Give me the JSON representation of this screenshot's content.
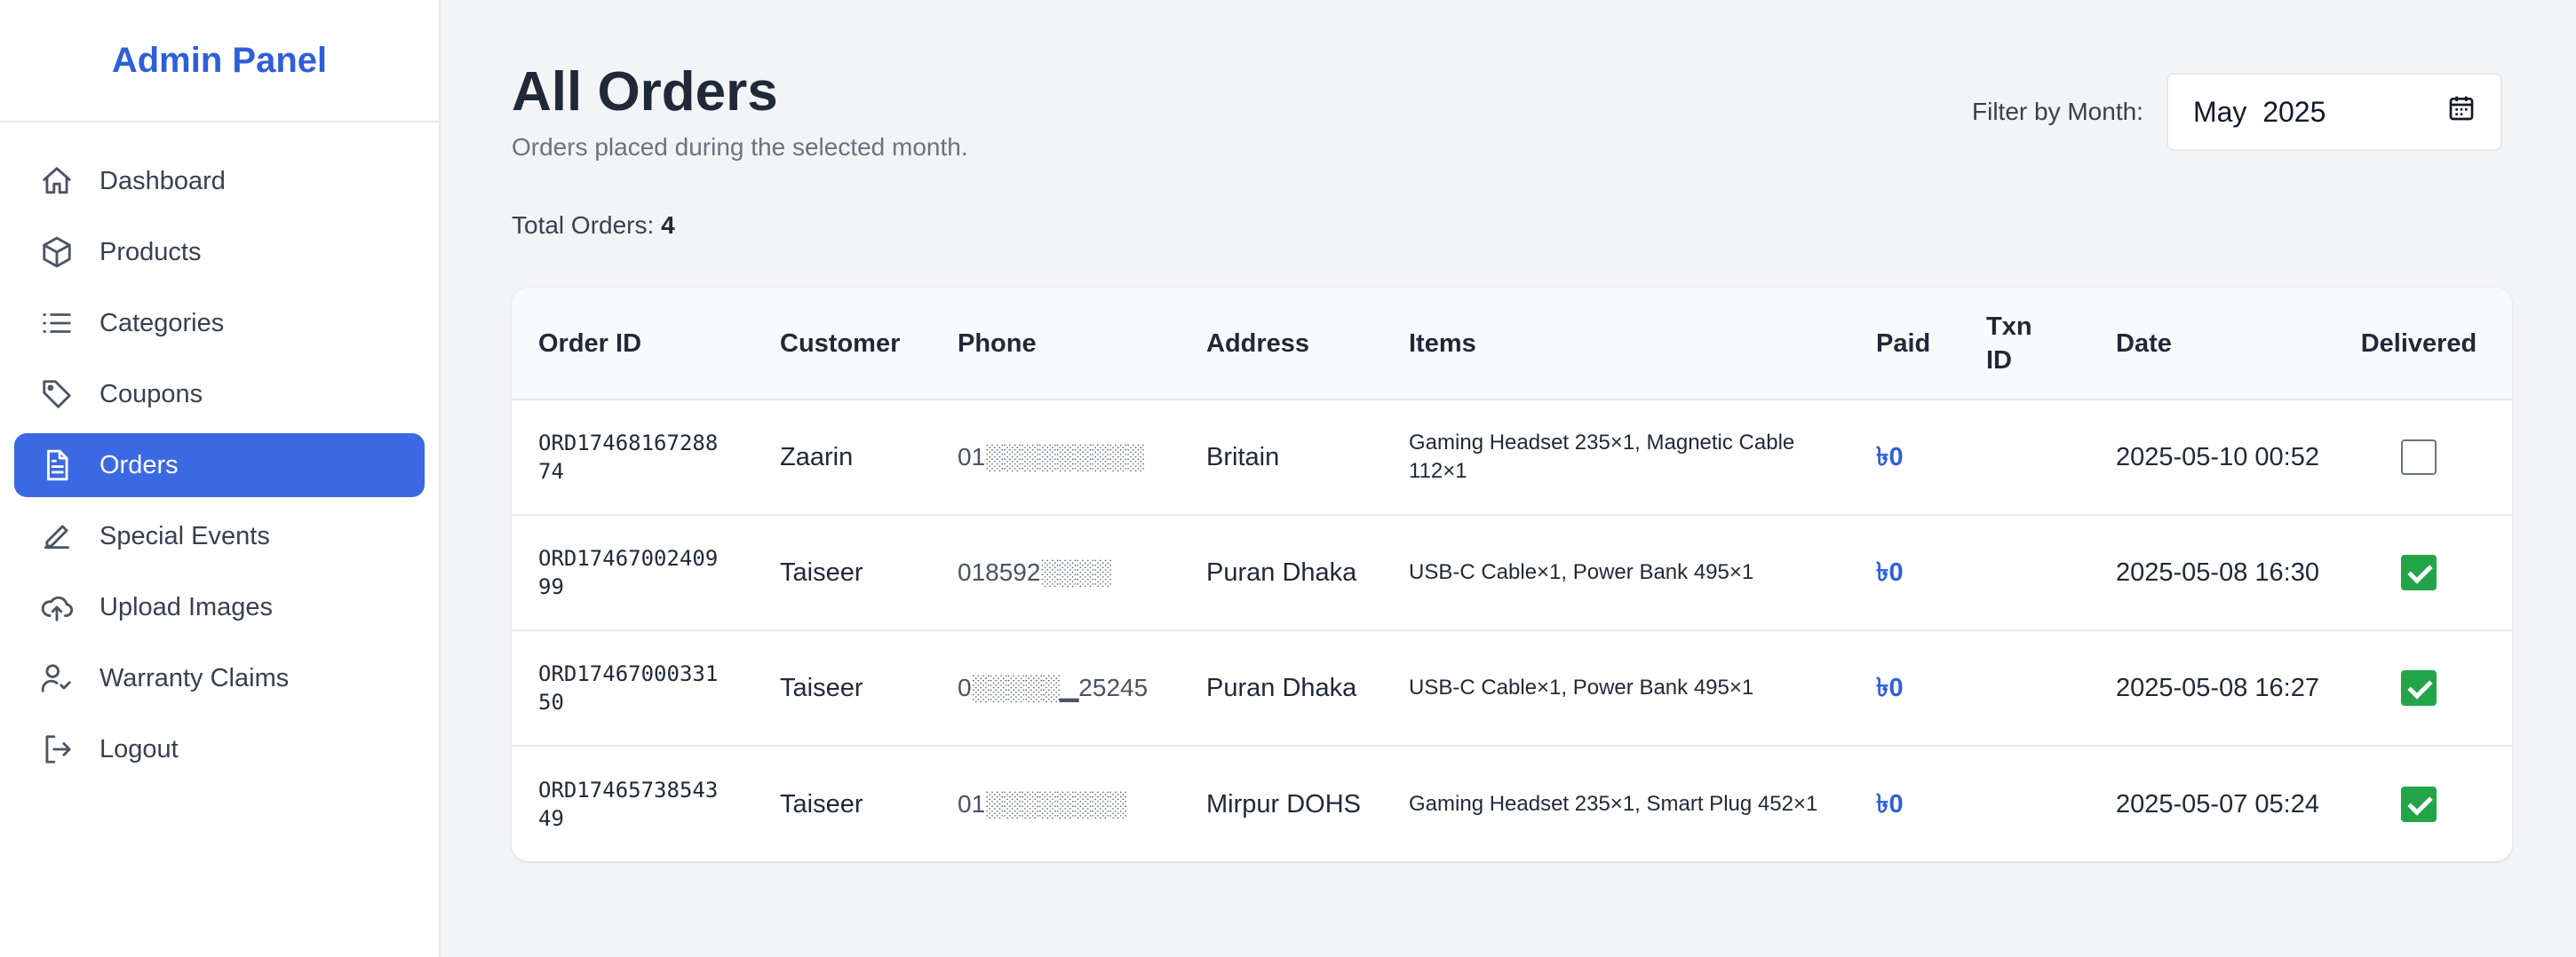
{
  "sidebar": {
    "brand": "Admin Panel",
    "items": [
      {
        "label": "Dashboard",
        "icon": "home-icon"
      },
      {
        "label": "Products",
        "icon": "box-icon"
      },
      {
        "label": "Categories",
        "icon": "list-icon"
      },
      {
        "label": "Coupons",
        "icon": "tag-icon"
      },
      {
        "label": "Orders",
        "icon": "document-icon",
        "active": true
      },
      {
        "label": "Special Events",
        "icon": "pen-icon"
      },
      {
        "label": "Upload Images",
        "icon": "cloud-upload-icon"
      },
      {
        "label": "Warranty Claims",
        "icon": "user-check-icon"
      },
      {
        "label": "Logout",
        "icon": "logout-icon"
      }
    ]
  },
  "header": {
    "title": "All Orders",
    "subtitle": "Orders placed during the selected month.",
    "total_label": "Total Orders:",
    "total_value": "4"
  },
  "filter": {
    "label": "Filter by Month:",
    "value": "May  2025"
  },
  "table": {
    "columns": [
      "Order ID",
      "Customer",
      "Phone",
      "Address",
      "Items",
      "Paid",
      "Txn ID",
      "Date",
      "Delivered"
    ],
    "rows": [
      {
        "order_id": "ORD17468167288 74",
        "customer": "Zaarin",
        "phone": "01░░░░░░░░░",
        "address": "Britain",
        "items": "Gaming Headset 235×1, Magnetic Cable 112×1",
        "paid": "৳0",
        "txn_id": "",
        "date": "2025-05-10 00:52",
        "delivered": false
      },
      {
        "order_id": "ORD17467002409 99",
        "customer": "Taiseer",
        "phone": "018592░░░░",
        "address": "Puran Dhaka",
        "items": "USB-C Cable×1, Power Bank 495×1",
        "paid": "৳0",
        "txn_id": "",
        "date": "2025-05-08 16:30",
        "delivered": true
      },
      {
        "order_id": "ORD17467000331 50",
        "customer": "Taiseer",
        "phone": "0░░░░░▁25245",
        "address": "Puran Dhaka",
        "items": "USB-C Cable×1, Power Bank 495×1",
        "paid": "৳0",
        "txn_id": "",
        "date": "2025-05-08 16:27",
        "delivered": true
      },
      {
        "order_id": "ORD17465738543 49",
        "customer": "Taiseer",
        "phone": "01░░░░░░░░",
        "address": "Mirpur DOHS",
        "items": "Gaming Headset 235×1, Smart Plug 452×1",
        "paid": "৳0",
        "txn_id": "",
        "date": "2025-05-07 05:24",
        "delivered": true
      }
    ]
  },
  "colors": {
    "accent": "#3b69e3",
    "brand": "#2f5fd8",
    "delivered": "#22a447"
  }
}
